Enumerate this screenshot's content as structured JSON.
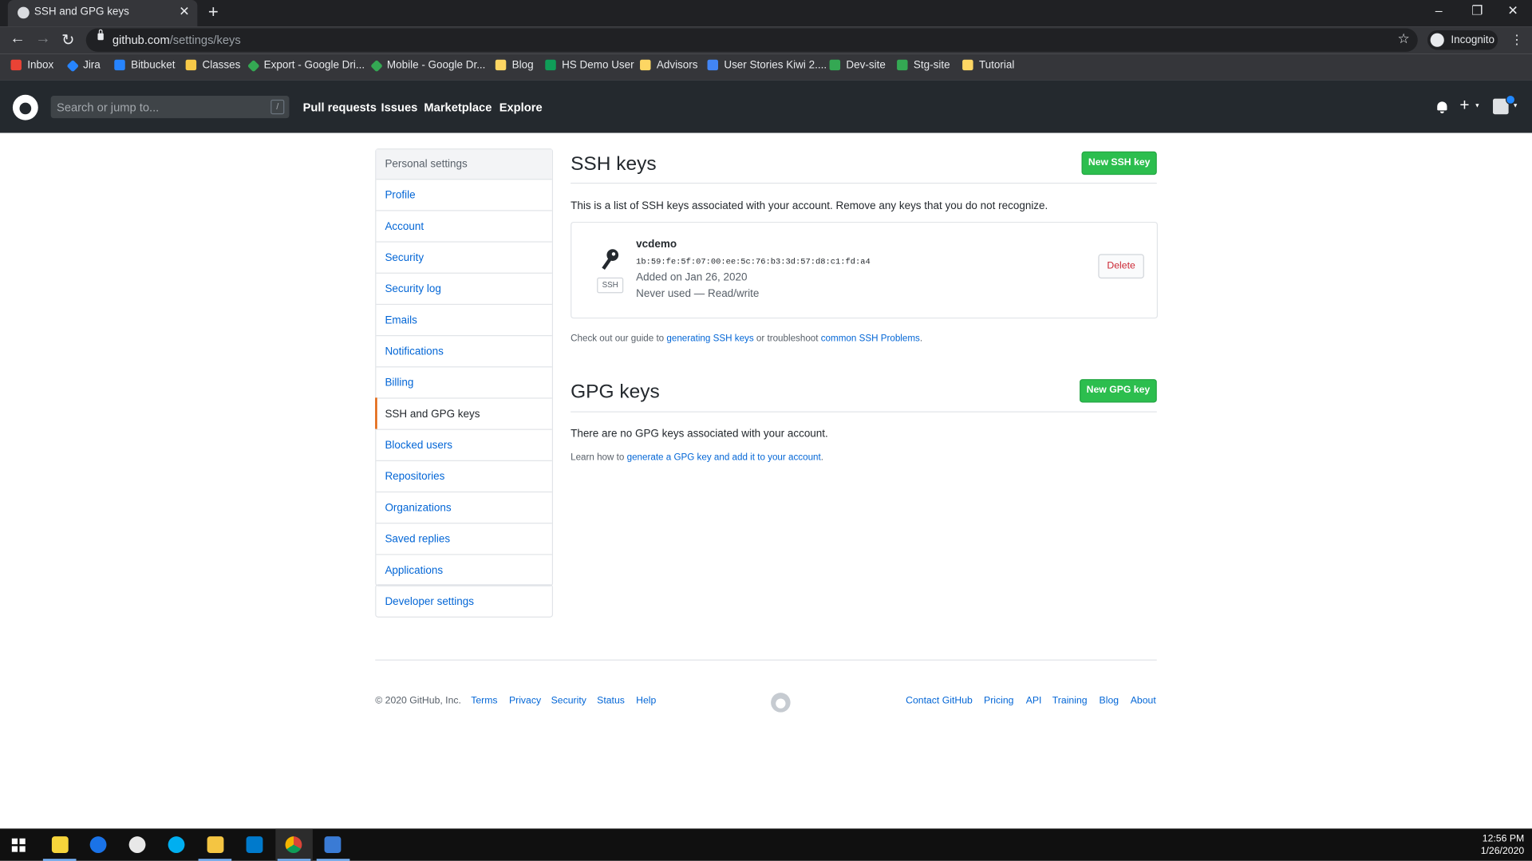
{
  "browser": {
    "tab_title": "SSH and GPG keys",
    "url_host": "github.com",
    "url_path": "/settings/keys",
    "profile_label": "Incognito",
    "bookmarks": [
      "Inbox",
      "Jira",
      "Bitbucket",
      "Classes",
      "Export - Google Dri...",
      "Mobile - Google Dr...",
      "Blog",
      "HS Demo User",
      "Advisors",
      "User Stories Kiwi 2....",
      "Dev-site",
      "Stg-site",
      "Tutorial"
    ]
  },
  "gh_header": {
    "search_placeholder": "Search or jump to...",
    "search_shortcut": "/",
    "nav": [
      "Pull requests",
      "Issues",
      "Marketplace",
      "Explore"
    ]
  },
  "sidebar": {
    "heading": "Personal settings",
    "items": [
      "Profile",
      "Account",
      "Security",
      "Security log",
      "Emails",
      "Notifications",
      "Billing",
      "SSH and GPG keys",
      "Blocked users",
      "Repositories",
      "Organizations",
      "Saved replies",
      "Applications"
    ],
    "selected": "SSH and GPG keys",
    "developer_settings": "Developer settings"
  },
  "ssh": {
    "title": "SSH keys",
    "new_button": "New SSH key",
    "description": "This is a list of SSH keys associated with your account. Remove any keys that you do not recognize.",
    "key": {
      "name": "vcdemo",
      "fingerprint": "1b:59:fe:5f:07:00:ee:5c:76:b3:3d:57:d8:c1:fd:a4",
      "added": "Added on Jan 26, 2020",
      "usage": "Never used — Read/write",
      "badge": "SSH",
      "delete_label": "Delete"
    },
    "guide_prefix": "Check out our guide to ",
    "guide_link1": "generating SSH keys",
    "guide_middle": " or troubleshoot ",
    "guide_link2": "common SSH Problems",
    "guide_suffix": "."
  },
  "gpg": {
    "title": "GPG keys",
    "new_button": "New GPG key",
    "empty_text": "There are no GPG keys associated with your account.",
    "learn_prefix": "Learn how to ",
    "learn_link": "generate a GPG key and add it to your account",
    "learn_suffix": "."
  },
  "footer": {
    "copyright": "© 2020 GitHub, Inc.",
    "left_links": [
      "Terms",
      "Privacy",
      "Security",
      "Status",
      "Help"
    ],
    "right_links": [
      "Contact GitHub",
      "Pricing",
      "API",
      "Training",
      "Blog",
      "About"
    ]
  },
  "taskbar": {
    "time": "12:56 PM",
    "date": "1/26/2020"
  }
}
